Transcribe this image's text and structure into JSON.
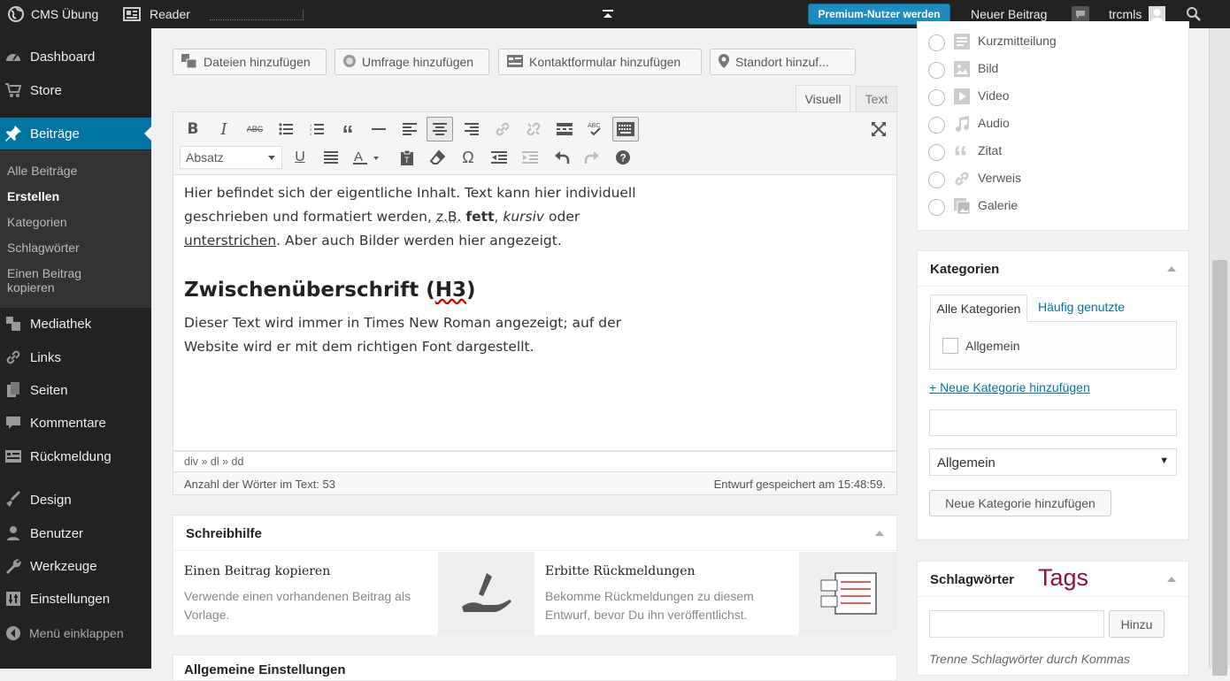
{
  "adminbar": {
    "site_name": "CMS Übung",
    "reader": "Reader",
    "premium_button": "Premium-Nutzer werden",
    "new_post": "Neuer Beitrag",
    "username": "trcmls"
  },
  "sidebar": {
    "items": [
      {
        "label": "Dashboard",
        "icon": "dashboard-icon"
      },
      {
        "label": "Store",
        "icon": "cart-icon"
      },
      {
        "label": "Beiträge",
        "icon": "pin-icon"
      },
      {
        "label": "Mediathek",
        "icon": "media-icon"
      },
      {
        "label": "Links",
        "icon": "link-icon"
      },
      {
        "label": "Seiten",
        "icon": "pages-icon"
      },
      {
        "label": "Kommentare",
        "icon": "comment-icon"
      },
      {
        "label": "Rückmeldung",
        "icon": "feedback-icon"
      },
      {
        "label": "Design",
        "icon": "brush-icon"
      },
      {
        "label": "Benutzer",
        "icon": "user-icon"
      },
      {
        "label": "Werkzeuge",
        "icon": "wrench-icon"
      },
      {
        "label": "Einstellungen",
        "icon": "settings-icon"
      }
    ],
    "submenu": [
      "Alle Beiträge",
      "Erstellen",
      "Kategorien",
      "Schlagwörter",
      "Einen Beitrag",
      "kopieren"
    ],
    "collapse": "Menü einklappen"
  },
  "media_buttons": {
    "files": "Dateien hinzufügen",
    "poll": "Umfrage hinzufügen",
    "contact": "Kontaktformular hinzufügen",
    "location": "Standort hinzuf..."
  },
  "editor": {
    "tab_visual": "Visuell",
    "tab_text": "Text",
    "format_select": "Absatz",
    "para1_line1": "Hier befindet sich der eigentliche Inhalt. Text kann hier individuell",
    "para1_line2a": "geschrieben und formatiert werden, ",
    "para1_zb": "z.B.",
    "para1_bold": "fett",
    "para1_comma": ", ",
    "para1_italic": "kursiv",
    "para1_oder": " oder",
    "para1_underline": "unterstrichen",
    "para1_rest": ". Aber auch Bilder werden hier angezeigt.",
    "heading_pre": "Zwischenüberschrift (",
    "heading_h3": "H3",
    "heading_post": ")",
    "para2_line1": "Dieser Text wird immer in Times New Roman angezeigt; auf der",
    "para2_line2": "Website wird er mit dem richtigen Font dargestellt.",
    "path": "div » dl » dd",
    "word_count": "Anzahl der Wörter im Text: 53",
    "draft_saved": "Entwurf gespeichert am 15:48:59."
  },
  "writing_help": {
    "title": "Schreibhilfe",
    "copy_title": "Einen Beitrag kopieren",
    "copy_desc1": "Verwende einen vorhandenen Beitrag als",
    "copy_desc2": "Vorlage.",
    "feedback_title": "Erbitte Rückmeldungen",
    "feedback_desc1": "Bekomme Rückmeldungen zu diesem",
    "feedback_desc2": "Entwurf, bevor Du ihn veröffentlichst."
  },
  "next_box_title": "Allgemeine Einstellungen",
  "formats": [
    {
      "label": "Kurzmitteilung",
      "icon": "aside-icon"
    },
    {
      "label": "Bild",
      "icon": "image-icon"
    },
    {
      "label": "Video",
      "icon": "video-icon"
    },
    {
      "label": "Audio",
      "icon": "audio-icon"
    },
    {
      "label": "Zitat",
      "icon": "quote-icon"
    },
    {
      "label": "Verweis",
      "icon": "link-icon"
    },
    {
      "label": "Galerie",
      "icon": "gallery-icon"
    }
  ],
  "categories": {
    "title": "Kategorien",
    "tab_all": "Alle Kategorien",
    "tab_popular": "Häufig genutzte",
    "item": "Allgemein",
    "add_link": "+ Neue Kategorie hinzufügen",
    "parent_select": "Allgemein",
    "add_button": "Neue Kategorie hinzufügen"
  },
  "tags": {
    "title": "Schlagwörter",
    "annotation": "Tags",
    "add_button": "Hinzu",
    "hint": "Trenne Schlagwörter durch Kommas"
  },
  "colors": {
    "accent": "#0074a2",
    "admin_bar": "#222222",
    "annotation": "#8b1538"
  }
}
